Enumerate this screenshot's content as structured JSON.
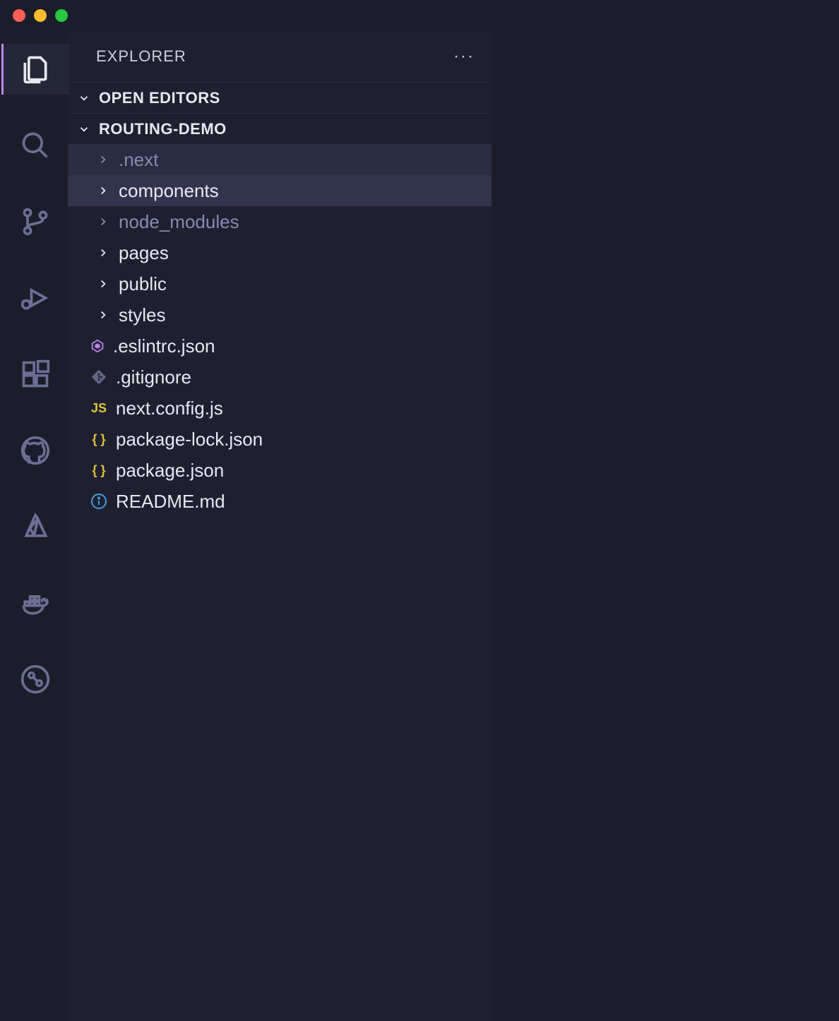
{
  "sidebar": {
    "title": "EXPLORER",
    "sections": {
      "open_editors": "OPEN EDITORS",
      "project": "ROUTING-DEMO"
    }
  },
  "activity_bar": {
    "items": [
      {
        "name": "explorer",
        "active": true
      },
      {
        "name": "search",
        "active": false
      },
      {
        "name": "source-control",
        "active": false
      },
      {
        "name": "run-debug",
        "active": false
      },
      {
        "name": "extensions",
        "active": false
      },
      {
        "name": "github",
        "active": false
      },
      {
        "name": "azure",
        "active": false
      },
      {
        "name": "docker",
        "active": false
      },
      {
        "name": "gitlens",
        "active": false
      }
    ]
  },
  "tree": [
    {
      "type": "folder",
      "name": ".next",
      "dimmed": true,
      "state": "hover"
    },
    {
      "type": "folder",
      "name": "components",
      "dimmed": false,
      "state": "selected"
    },
    {
      "type": "folder",
      "name": "node_modules",
      "dimmed": true,
      "state": "none"
    },
    {
      "type": "folder",
      "name": "pages",
      "dimmed": false,
      "state": "none"
    },
    {
      "type": "folder",
      "name": "public",
      "dimmed": false,
      "state": "none"
    },
    {
      "type": "folder",
      "name": "styles",
      "dimmed": false,
      "state": "none"
    },
    {
      "type": "file",
      "name": ".eslintrc.json",
      "icon": "eslint"
    },
    {
      "type": "file",
      "name": ".gitignore",
      "icon": "git"
    },
    {
      "type": "file",
      "name": "next.config.js",
      "icon": "js"
    },
    {
      "type": "file",
      "name": "package-lock.json",
      "icon": "json"
    },
    {
      "type": "file",
      "name": "package.json",
      "icon": "json"
    },
    {
      "type": "file",
      "name": "README.md",
      "icon": "readme"
    }
  ]
}
